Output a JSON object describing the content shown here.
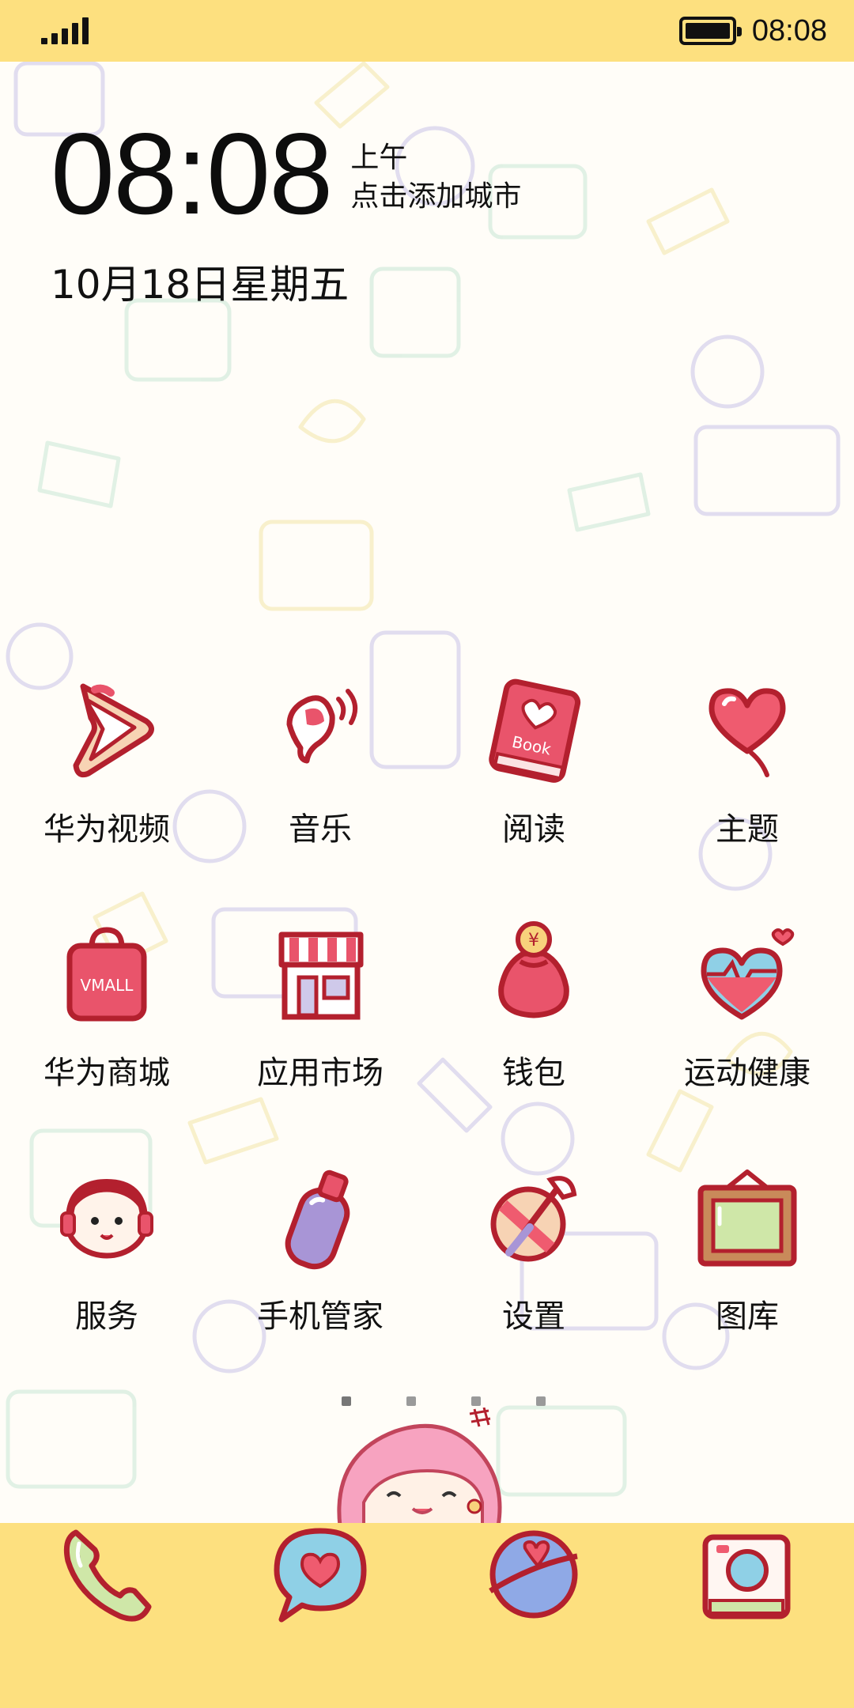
{
  "status_bar": {
    "time": "08:08",
    "signal_icon": "signal-bars-icon",
    "battery_icon": "battery-full-icon"
  },
  "clock": {
    "time": "08:08",
    "ampm": "上午",
    "city_prompt": "点击添加城市",
    "date": "10月18日星期五"
  },
  "apps": [
    [
      {
        "label": "华为视频",
        "icon": "video-play-icon"
      },
      {
        "label": "音乐",
        "icon": "music-note-icon"
      },
      {
        "label": "阅读",
        "icon": "book-icon"
      },
      {
        "label": "主题",
        "icon": "heart-balloon-icon"
      }
    ],
    [
      {
        "label": "华为商城",
        "icon": "vmall-bag-icon",
        "icon_text": "VMALL"
      },
      {
        "label": "应用市场",
        "icon": "store-icon"
      },
      {
        "label": "钱包",
        "icon": "money-bag-icon"
      },
      {
        "label": "运动健康",
        "icon": "heart-health-icon"
      }
    ],
    [
      {
        "label": "服务",
        "icon": "service-face-icon"
      },
      {
        "label": "手机管家",
        "icon": "phone-manager-icon"
      },
      {
        "label": "设置",
        "icon": "settings-icon"
      },
      {
        "label": "图库",
        "icon": "gallery-frame-icon"
      }
    ]
  ],
  "page_indicator": {
    "count": 4,
    "active": 0
  },
  "dock": [
    {
      "icon": "phone-icon"
    },
    {
      "icon": "messages-icon"
    },
    {
      "icon": "browser-planet-icon"
    },
    {
      "icon": "camera-icon"
    }
  ],
  "colors": {
    "bar_yellow": "#fde07f",
    "icon_red": "#b3202e",
    "icon_pink": "#e9546b"
  }
}
